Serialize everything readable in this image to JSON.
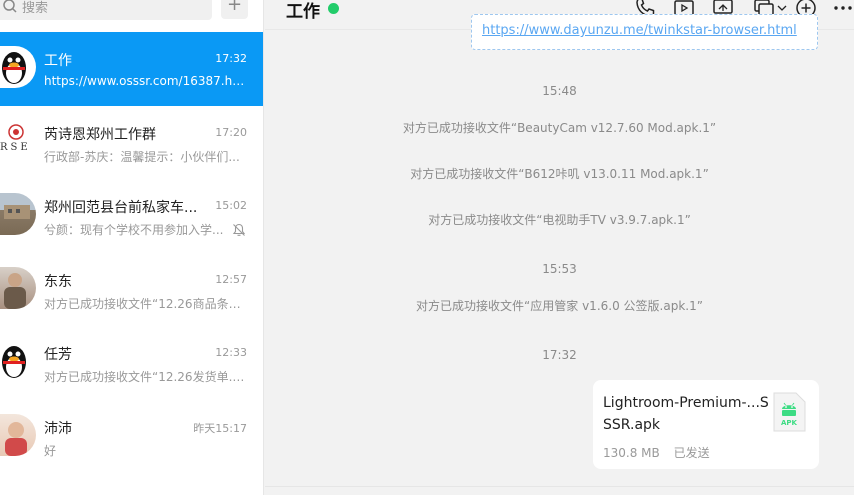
{
  "search": {
    "placeholder": "搜索",
    "add_label": "+"
  },
  "chats": [
    {
      "name": "工作",
      "time": "17:32",
      "preview": "https://www.osssr.com/16387.html",
      "active": true,
      "avatar": "penguin-avatar"
    },
    {
      "name": "芮诗恩郑州工作群",
      "time": "17:20",
      "preview": "行政部-苏庆：温馨提示：小伙伴们...",
      "avatar": "group-logo-avatar",
      "avatar_text": "RSE"
    },
    {
      "name": "郑州回范县台前私家车...",
      "time": "15:02",
      "preview": "兮颜：现有个学校不用参加入学...",
      "muted": true,
      "avatar": "building-photo-avatar"
    },
    {
      "name": "东东",
      "time": "12:57",
      "preview": "对方已成功接收文件“12.26商品条码...",
      "avatar": "photo-avatar"
    },
    {
      "name": "任芳",
      "time": "12:33",
      "preview": "对方已成功接收文件“12.26发货单.xl...",
      "avatar": "penguin-avatar"
    },
    {
      "name": "沛沛",
      "time": "昨天15:17",
      "preview": "好",
      "avatar": "photo-avatar"
    }
  ],
  "conversation": {
    "title": "工作",
    "status_color": "#22cc6a",
    "link_text": "https://www.dayunzu.me/twinkstar-browser.html",
    "messages": {
      "t1": "15:48",
      "m1": "对方已成功接收文件“BeautyCam v12.7.60 Mod.apk.1”",
      "m2": "对方已成功接收文件“B612咔叽 v13.0.11 Mod.apk.1”",
      "m3": "对方已成功接收文件“电视助手TV v3.9.7.apk.1”",
      "t2": "15:53",
      "m4": "对方已成功接收文件“应用管家 v1.6.0 公签版.apk.1”",
      "t3": "17:32"
    },
    "file": {
      "name": "Lightroom-Premium-...SSSR.apk",
      "size": "130.8 MB",
      "status": "已发送",
      "type_label": "APK"
    }
  },
  "colors": {
    "accent": "#0a99f5",
    "apk_green": "#3ddc84"
  }
}
